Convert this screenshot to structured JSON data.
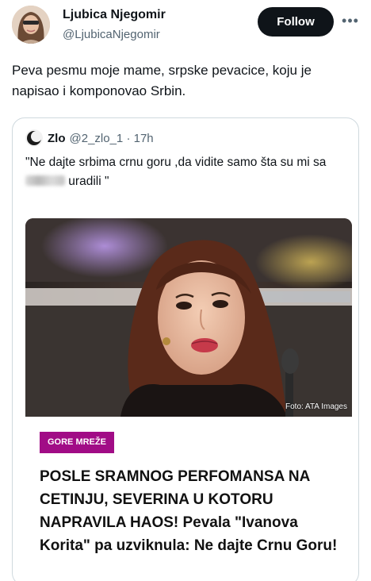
{
  "author": {
    "name": "Ljubica Njegomir",
    "handle": "@LjubicaNjegomir"
  },
  "actions": {
    "follow_label": "Follow",
    "more_icon": "more-horizontal-icon"
  },
  "tweet": {
    "text": "Peva pesmu moje mame, srpske pevacice, koju je napisao i komponovao Srbin."
  },
  "quoted": {
    "name": "Zlo",
    "handle_time": "@2_zlo_1 · 17h",
    "text_before": "\"Ne dajte srbima crnu goru ,da vidite samo šta su mi sa ",
    "text_after": " uradili \""
  },
  "article": {
    "photo_credit": "Foto: ATA Images",
    "category": "GORE MREŽE",
    "headline": "POSLE SRAMNOG PERFOMANSA NA CETINJU, SEVERINA U KOTORU NAPRAVILA HAOS! Pevala \"Ivanova Korita\" pa uzviknula: Ne dajte Crnu Goru!"
  },
  "colors": {
    "follow_bg": "#0f1419",
    "category_bg": "#a10c86",
    "secondary_text": "#536471"
  }
}
